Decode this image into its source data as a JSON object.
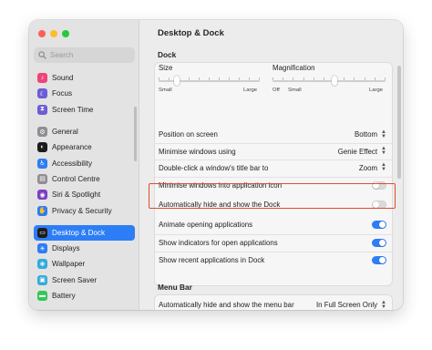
{
  "window": {
    "title": "Desktop & Dock"
  },
  "sidebar": {
    "search_placeholder": "Search",
    "items": [
      {
        "label": "Sound",
        "icon": "sound-icon",
        "color": "#f0437a",
        "glyph": "♪"
      },
      {
        "label": "Focus",
        "icon": "moon-icon",
        "color": "#6c5cd6",
        "glyph": "☾"
      },
      {
        "label": "Screen Time",
        "icon": "hourglass-icon",
        "color": "#6c5cd6",
        "glyph": "⧗"
      },
      {
        "label": "General",
        "icon": "gear-icon",
        "color": "#8e8e93",
        "glyph": "⚙"
      },
      {
        "label": "Appearance",
        "icon": "appearance-icon",
        "color": "#1c1c1e",
        "glyph": "◐"
      },
      {
        "label": "Accessibility",
        "icon": "accessibility-icon",
        "color": "#2d7df6",
        "glyph": "♿"
      },
      {
        "label": "Control Centre",
        "icon": "control-centre-icon",
        "color": "#8e8e93",
        "glyph": "▤"
      },
      {
        "label": "Siri & Spotlight",
        "icon": "siri-icon",
        "color": "#7a3fc2",
        "glyph": "◉"
      },
      {
        "label": "Privacy & Security",
        "icon": "hand-icon",
        "color": "#2d7df6",
        "glyph": "✋"
      },
      {
        "label": "Desktop & Dock",
        "icon": "dock-icon",
        "color": "#1c1c1e",
        "glyph": "▭",
        "active": true
      },
      {
        "label": "Displays",
        "icon": "display-icon",
        "color": "#2d7df6",
        "glyph": "☀"
      },
      {
        "label": "Wallpaper",
        "icon": "wallpaper-icon",
        "color": "#34aadc",
        "glyph": "❋"
      },
      {
        "label": "Screen Saver",
        "icon": "screen-saver-icon",
        "color": "#34aadc",
        "glyph": "▣"
      },
      {
        "label": "Battery",
        "icon": "battery-icon",
        "color": "#34c759",
        "glyph": "▬"
      }
    ]
  },
  "dock_section": {
    "title": "Dock",
    "size": {
      "label": "Size",
      "min": "Small",
      "max": "Large",
      "value": 0.18
    },
    "magnification": {
      "label": "Magnification",
      "min": "Off",
      "min2": "Small",
      "max": "Large",
      "value": 0.55
    },
    "rows": [
      {
        "label": "Position on screen",
        "type": "select",
        "value": "Bottom"
      },
      {
        "label": "Minimise windows using",
        "type": "select",
        "value": "Genie Effect"
      },
      {
        "label": "Double-click a window's title bar to",
        "type": "select",
        "value": "Zoom"
      },
      {
        "label": "Minimise windows into application icon",
        "type": "toggle",
        "on": false
      },
      {
        "label": "Automatically hide and show the Dock",
        "type": "toggle",
        "on": false,
        "highlighted": true
      },
      {
        "label": "Animate opening applications",
        "type": "toggle",
        "on": true
      },
      {
        "label": "Show indicators for open applications",
        "type": "toggle",
        "on": true
      },
      {
        "label": "Show recent applications in Dock",
        "type": "toggle",
        "on": true
      }
    ]
  },
  "menu_bar_section": {
    "title": "Menu Bar",
    "rows": [
      {
        "label": "Automatically hide and show the menu bar",
        "type": "select",
        "value": "In Full Screen Only"
      }
    ]
  },
  "colors": {
    "accent": "#2d7df6",
    "highlight": "#e34b31"
  }
}
